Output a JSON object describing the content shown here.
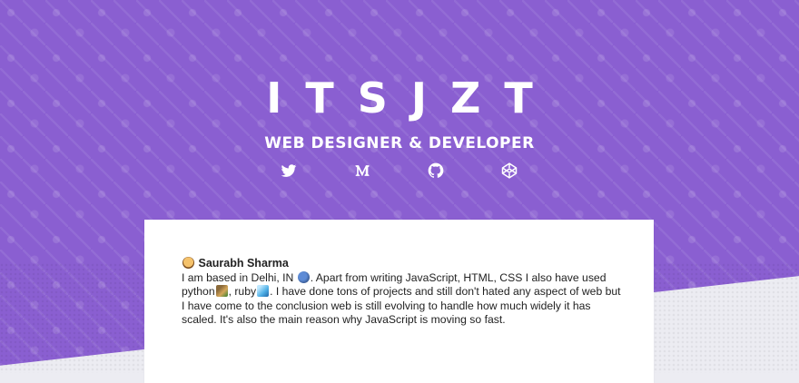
{
  "hero": {
    "title": "ITSJZT",
    "subtitle": "WEB DESIGNER & DEVELOPER",
    "colors": {
      "background": "#8a5fd1",
      "text": "#ffffff"
    }
  },
  "social_links": [
    {
      "name": "twitter",
      "icon": "twitter-icon"
    },
    {
      "name": "medium",
      "icon": "medium-icon"
    },
    {
      "name": "github",
      "icon": "github-icon"
    },
    {
      "name": "codepen",
      "icon": "codepen-icon"
    }
  ],
  "about": {
    "author_name": "Saurabh Sharma",
    "text_1": "I am based in Delhi, IN",
    "text_2": ". Apart from writing JavaScript, HTML, CSS I also have used python",
    "text_3": ", ruby",
    "text_4": ". I have done tons of projects and still don't hated any aspect of web but I have come to the conclusion web is still evolving to handle how much widely it has scaled. It's also the main reason why JavaScript is moving so fast."
  }
}
